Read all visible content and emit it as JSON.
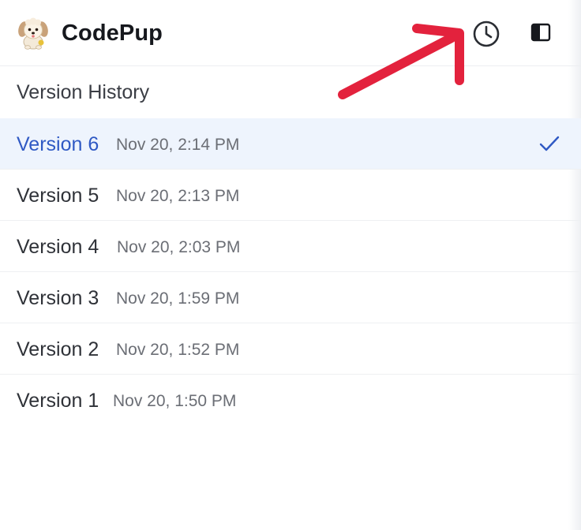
{
  "app": {
    "title": "CodePup",
    "logo_icon": "puppy-logo-icon"
  },
  "toolbar": {
    "history_icon": "clock-icon",
    "sidebar_icon": "sidebar-toggle-icon"
  },
  "annotation": {
    "arrow_color": "#e3223d",
    "points_to": "history-button"
  },
  "panel": {
    "title": "Version History",
    "selected_color": "#2f59c4",
    "selected_bg": "#eef4fd"
  },
  "versions": [
    {
      "name": "Version 6",
      "date": "Nov 20, 2:14 PM",
      "selected": true
    },
    {
      "name": "Version 5",
      "date": "Nov 20, 2:13 PM",
      "selected": false
    },
    {
      "name": "Version 4",
      "date": "Nov 20, 2:03 PM",
      "selected": false
    },
    {
      "name": "Version 3",
      "date": "Nov 20, 1:59 PM",
      "selected": false
    },
    {
      "name": "Version 2",
      "date": "Nov 20, 1:52 PM",
      "selected": false
    },
    {
      "name": "Version 1",
      "date": "Nov 20, 1:50 PM",
      "selected": false
    }
  ]
}
